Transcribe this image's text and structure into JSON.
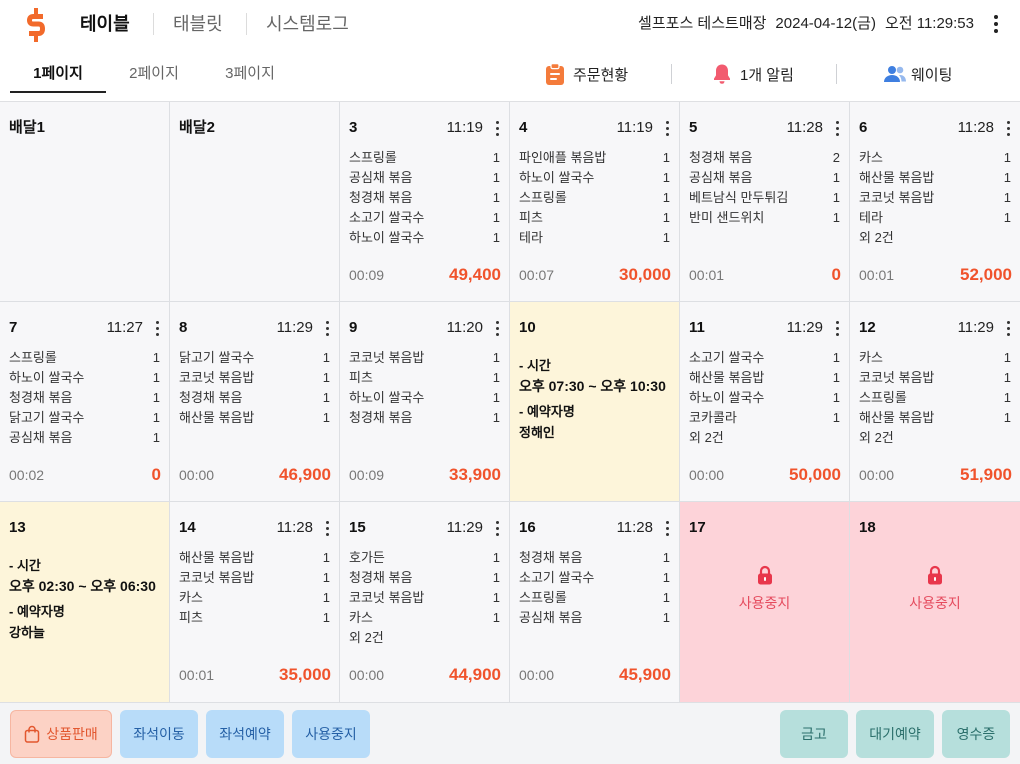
{
  "colors": {
    "brand": "#f26a2b",
    "amount": "#f0532c",
    "reserved_bg": "#fdf5da",
    "disabled_bg": "#fdd3d9",
    "disabled_text": "#e54b5e",
    "lock": "#e8364b",
    "clipboard": "#f47b3b",
    "bell": "#f25b6f",
    "people": "#3f7fe0",
    "sale_text": "#e2572f",
    "sale_bg": "#fcd2c5",
    "blue_btn_bg": "#b8dcf9",
    "blue_btn_text": "#245fa5",
    "teal_btn_bg": "#b6dfdc",
    "teal_btn_text": "#2b6f6b"
  },
  "header": {
    "logo_icon": "selfpos-s-logo",
    "nav": [
      {
        "label": "테이블"
      },
      {
        "label": "태블릿"
      },
      {
        "label": "시스템로그"
      }
    ],
    "store_name": "셀프포스 테스트매장",
    "date": "2024-04-12(금)",
    "time": "오전 11:29:53",
    "menu_icon": "more-vertical-icon"
  },
  "pages": {
    "tabs": [
      {
        "label": "1페이지"
      },
      {
        "label": "2페이지"
      },
      {
        "label": "3페이지"
      }
    ],
    "actions": [
      {
        "label": "주문현황",
        "icon": "clipboard-icon"
      },
      {
        "label": "1개 알림",
        "icon": "bell-icon"
      },
      {
        "label": "웨이팅",
        "icon": "people-icon"
      }
    ]
  },
  "tables": [
    {
      "name": "배달1"
    },
    {
      "name": "배달2"
    },
    {
      "name": "3",
      "order_time": "11:19",
      "items": [
        {
          "name": "스프링롤",
          "qty": "1"
        },
        {
          "name": "공심채 볶음",
          "qty": "1"
        },
        {
          "name": "청경채 볶음",
          "qty": "1"
        },
        {
          "name": "소고기 쌀국수",
          "qty": "1"
        },
        {
          "name": "하노이 쌀국수",
          "qty": "1"
        }
      ],
      "elapsed": "00:09",
      "amount": "49,400"
    },
    {
      "name": "4",
      "order_time": "11:19",
      "items": [
        {
          "name": "파인애플 볶음밥",
          "qty": "1"
        },
        {
          "name": "하노이 쌀국수",
          "qty": "1"
        },
        {
          "name": "스프링롤",
          "qty": "1"
        },
        {
          "name": "피츠",
          "qty": "1"
        },
        {
          "name": "테라",
          "qty": "1"
        }
      ],
      "elapsed": "00:07",
      "amount": "30,000"
    },
    {
      "name": "5",
      "order_time": "11:28",
      "items": [
        {
          "name": "청경채 볶음",
          "qty": "2"
        },
        {
          "name": "공심채 볶음",
          "qty": "1"
        },
        {
          "name": "베트남식 만두튀김",
          "qty": "1"
        },
        {
          "name": "반미 샌드위치",
          "qty": "1"
        }
      ],
      "elapsed": "00:01",
      "amount": "0"
    },
    {
      "name": "6",
      "order_time": "11:28",
      "items": [
        {
          "name": "카스",
          "qty": "1"
        },
        {
          "name": "해산물 볶음밥",
          "qty": "1"
        },
        {
          "name": "코코넛 볶음밥",
          "qty": "1"
        },
        {
          "name": "테라",
          "qty": "1"
        }
      ],
      "more": "외 2건",
      "elapsed": "00:01",
      "amount": "52,000"
    },
    {
      "name": "7",
      "order_time": "11:27",
      "items": [
        {
          "name": "스프링롤",
          "qty": "1"
        },
        {
          "name": "하노이 쌀국수",
          "qty": "1"
        },
        {
          "name": "청경채 볶음",
          "qty": "1"
        },
        {
          "name": "닭고기 쌀국수",
          "qty": "1"
        },
        {
          "name": "공심채 볶음",
          "qty": "1"
        }
      ],
      "elapsed": "00:02",
      "amount": "0"
    },
    {
      "name": "8",
      "order_time": "11:29",
      "items": [
        {
          "name": "닭고기 쌀국수",
          "qty": "1"
        },
        {
          "name": "코코넛 볶음밥",
          "qty": "1"
        },
        {
          "name": "청경채 볶음",
          "qty": "1"
        },
        {
          "name": "해산물 볶음밥",
          "qty": "1"
        }
      ],
      "elapsed": "00:00",
      "amount": "46,900"
    },
    {
      "name": "9",
      "order_time": "11:20",
      "items": [
        {
          "name": "코코넛 볶음밥",
          "qty": "1"
        },
        {
          "name": "피츠",
          "qty": "1"
        },
        {
          "name": "하노이 쌀국수",
          "qty": "1"
        },
        {
          "name": "청경채 볶음",
          "qty": "1"
        }
      ],
      "elapsed": "00:09",
      "amount": "33,900"
    },
    {
      "name": "10",
      "time_label": "- 시간",
      "time_range": "오후 07:30 ~ 오후 10:30",
      "guest_label": "- 예약자명",
      "guest": "정해인"
    },
    {
      "name": "11",
      "order_time": "11:29",
      "items": [
        {
          "name": "소고기 쌀국수",
          "qty": "1"
        },
        {
          "name": "해산물 볶음밥",
          "qty": "1"
        },
        {
          "name": "하노이 쌀국수",
          "qty": "1"
        },
        {
          "name": "코카콜라",
          "qty": "1"
        }
      ],
      "more": "외 2건",
      "elapsed": "00:00",
      "amount": "50,000"
    },
    {
      "name": "12",
      "order_time": "11:29",
      "items": [
        {
          "name": "카스",
          "qty": "1"
        },
        {
          "name": "코코넛 볶음밥",
          "qty": "1"
        },
        {
          "name": "스프링롤",
          "qty": "1"
        },
        {
          "name": "해산물 볶음밥",
          "qty": "1"
        }
      ],
      "more": "외 2건",
      "elapsed": "00:00",
      "amount": "51,900"
    },
    {
      "name": "13",
      "time_label": "- 시간",
      "time_range": "오후 02:30 ~ 오후 06:30",
      "guest_label": "- 예약자명",
      "guest": "강하늘"
    },
    {
      "name": "14",
      "order_time": "11:28",
      "items": [
        {
          "name": "해산물 볶음밥",
          "qty": "1"
        },
        {
          "name": "코코넛 볶음밥",
          "qty": "1"
        },
        {
          "name": "카스",
          "qty": "1"
        },
        {
          "name": "피츠",
          "qty": "1"
        }
      ],
      "elapsed": "00:01",
      "amount": "35,000"
    },
    {
      "name": "15",
      "order_time": "11:29",
      "items": [
        {
          "name": "호가든",
          "qty": "1"
        },
        {
          "name": "청경채 볶음",
          "qty": "1"
        },
        {
          "name": "코코넛 볶음밥",
          "qty": "1"
        },
        {
          "name": "카스",
          "qty": "1"
        }
      ],
      "more": "외 2건",
      "elapsed": "00:00",
      "amount": "44,900"
    },
    {
      "name": "16",
      "order_time": "11:28",
      "items": [
        {
          "name": "청경채 볶음",
          "qty": "1"
        },
        {
          "name": "소고기 쌀국수",
          "qty": "1"
        },
        {
          "name": "스프링롤",
          "qty": "1"
        },
        {
          "name": "공심채 볶음",
          "qty": "1"
        }
      ],
      "elapsed": "00:00",
      "amount": "45,900"
    },
    {
      "name": "17",
      "status": "사용중지",
      "icon": "lock-icon"
    },
    {
      "name": "18",
      "status": "사용중지",
      "icon": "lock-icon"
    }
  ],
  "bottom_bar": {
    "left": [
      {
        "label": "상품판매",
        "icon": "shopping-bag-icon"
      },
      {
        "label": "좌석이동"
      },
      {
        "label": "좌석예약"
      },
      {
        "label": "사용중지"
      }
    ],
    "right": [
      {
        "label": "금고"
      },
      {
        "label": "대기예약"
      },
      {
        "label": "영수증"
      }
    ]
  }
}
